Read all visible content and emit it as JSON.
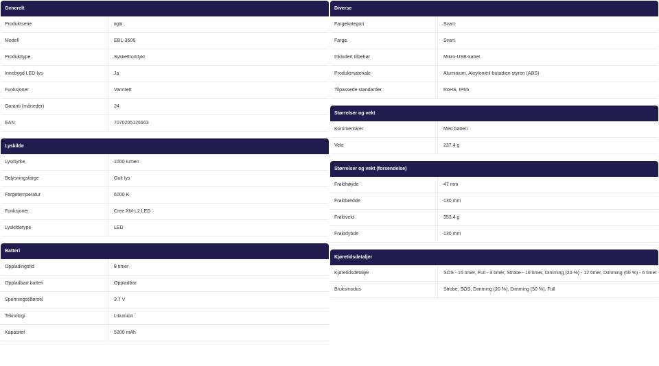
{
  "left_sections": [
    {
      "title": "Generelt",
      "rows": [
        {
          "label": "Produktserie",
          "value": "iiglo"
        },
        {
          "label": "Modell",
          "value": "EBL-3606"
        },
        {
          "label": "Produkttype",
          "value": "Sykkelfrontlykt"
        },
        {
          "label": "Innebygd LED-lys",
          "value": "Ja"
        },
        {
          "label": "Funksjoner",
          "value": "Vanntett"
        },
        {
          "label": "Garanti (måneder)",
          "value": "24"
        },
        {
          "label": "EAN",
          "value": "7070205126563"
        }
      ]
    },
    {
      "title": "Lyskilde",
      "rows": [
        {
          "label": "Lysstyrke",
          "value": "1000 lumen"
        },
        {
          "label": "Belysningsfarge",
          "value": "Gult lys"
        },
        {
          "label": "Fargetemperatur",
          "value": "6000 K"
        },
        {
          "label": "Funksjoner",
          "value": "Cree XM-L2 LED"
        },
        {
          "label": "Lyskildetype",
          "value": "LED"
        }
      ]
    },
    {
      "title": "Batteri",
      "rows": [
        {
          "label": "Oppladingstid",
          "value": "8 timer"
        },
        {
          "label": "Oppladbart batteri",
          "value": "Oppladbar"
        },
        {
          "label": "Spenningstilførsel",
          "value": "3.7 V"
        },
        {
          "label": "Teknologi",
          "value": "Litiumion"
        },
        {
          "label": "Kapasitet",
          "value": "5200 mAh"
        }
      ]
    }
  ],
  "right_sections": [
    {
      "title": "Diverse",
      "rows": [
        {
          "label": "Fargekategori",
          "value": "Svart"
        },
        {
          "label": "Farge",
          "value": "Svart"
        },
        {
          "label": "Inkludert tilbehør",
          "value": "Mikro-USB-kabel"
        },
        {
          "label": "Produktmateriale",
          "value": "Aluminium, Akrylonitril-butadien styren (ABS)"
        },
        {
          "label": "Tilpassede standarder",
          "value": "RoHS, IP65"
        }
      ]
    },
    {
      "title": "Størrelser og vekt",
      "rows": [
        {
          "label": "Kommentarer",
          "value": "Med batteri"
        },
        {
          "label": "Vekt",
          "value": "237.4 g"
        }
      ]
    },
    {
      "title": "Størrelser og vekt (forsendelse)",
      "rows": [
        {
          "label": "Frakthøyde",
          "value": "47 mm"
        },
        {
          "label": "Fraktbredde",
          "value": "130 mm"
        },
        {
          "label": "Fraktvekt",
          "value": "353.4 g"
        },
        {
          "label": "Fraktdybde",
          "value": "130 mm"
        }
      ]
    },
    {
      "title": "Kjøretidsdetaljer",
      "rows": [
        {
          "label": "Kjøretidsdetaljer",
          "value": "SOS - 15 timer, Full - 3 timer, Strobe - 10 timer, Dimming (20 %) - 12 timer, Dimming (50 %) - 6 timer"
        },
        {
          "label": "Bruksmodus",
          "value": "Strobe, SOS, Dimming (20 %), Dimming (50 %), Full"
        }
      ]
    }
  ]
}
